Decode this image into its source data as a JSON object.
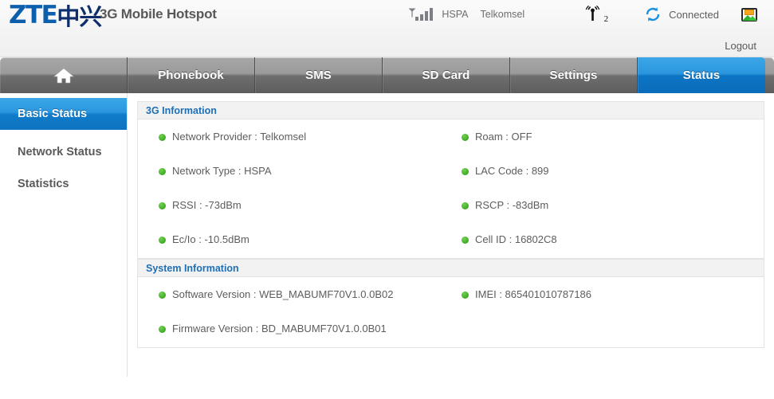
{
  "header": {
    "logo_zte": "ZTE",
    "logo_cn": "中兴",
    "app_title": "3G Mobile Hotspot",
    "network_tech": "HSPA",
    "operator": "Telkomsel",
    "ap_clients": "2",
    "connection_status": "Connected",
    "logout_label": "Logout",
    "icons": {
      "signal": "signal-bars-icon",
      "access_point": "access-point-icon",
      "refresh": "refresh-icon",
      "message": "message-icon"
    }
  },
  "nav": {
    "home_icon": "home-icon",
    "tabs": [
      {
        "label": "",
        "name": "tab-home",
        "active": false
      },
      {
        "label": "Phonebook",
        "name": "tab-phonebook",
        "active": false
      },
      {
        "label": "SMS",
        "name": "tab-sms",
        "active": false
      },
      {
        "label": "SD Card",
        "name": "tab-sdcard",
        "active": false
      },
      {
        "label": "Settings",
        "name": "tab-settings",
        "active": false
      },
      {
        "label": "Status",
        "name": "tab-status",
        "active": true
      }
    ]
  },
  "sidebar": {
    "items": [
      {
        "label": "Basic Status",
        "active": true
      },
      {
        "label": "Network Status",
        "active": false
      },
      {
        "label": "Statistics",
        "active": false
      }
    ]
  },
  "panels": {
    "threeg": {
      "title": "3G Information",
      "rows": [
        {
          "left": "Network Provider : Telkomsel",
          "right": "Roam : OFF"
        },
        {
          "left": "Network Type : HSPA",
          "right": "LAC Code  : 899"
        },
        {
          "left": "RSSI :  -73dBm",
          "right": "RSCP :  -83dBm"
        },
        {
          "left": "Ec/Io  :  -10.5dBm",
          "right": "Cell ID  : 16802C8"
        }
      ]
    },
    "system": {
      "title": "System Information",
      "rows": [
        {
          "left": "Software Version : WEB_MABUMF70V1.0.0B02",
          "right": "IMEI : 865401010787186"
        },
        {
          "left": "Firmware Version : BD_MABUMF70V1.0.0B01",
          "right": ""
        }
      ]
    }
  },
  "colors": {
    "accent_blue": "#1f7cc4",
    "logo_blue": "#0b5fad",
    "status_green": "#3faa25",
    "nav_gray": "#6e6e6e"
  }
}
